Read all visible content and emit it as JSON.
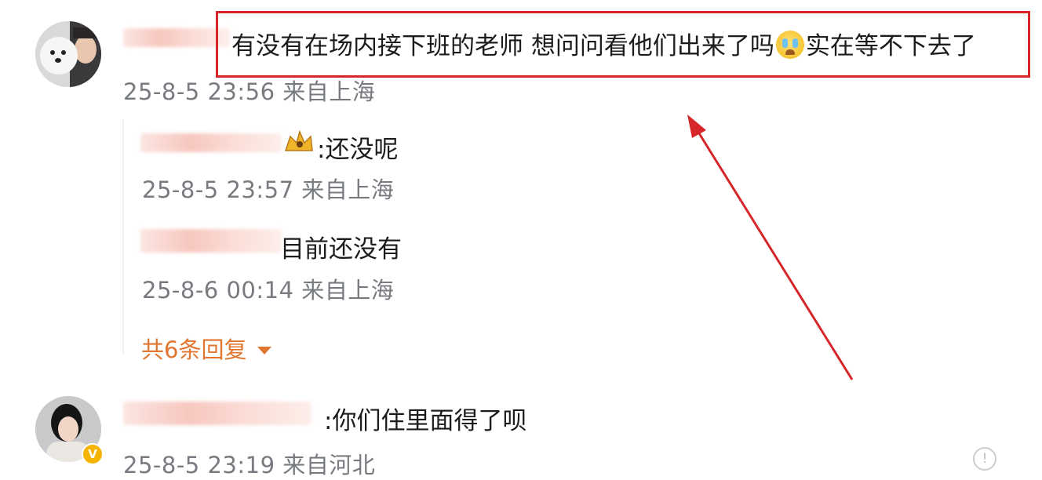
{
  "comments": [
    {
      "text": "有没有在场内接下班的老师 想问问看他们出来了吗",
      "emoji": "crying-face",
      "text_after_emoji": "实在等不下去了",
      "time": "25-8-5 23:56 来自上海",
      "replies": [
        {
          "text": ":还没呢",
          "time": "25-8-5 23:57 来自上海"
        },
        {
          "text": "目前还没有",
          "time": "25-8-6 00:14 来自上海"
        }
      ],
      "more_replies": "共6条回复"
    },
    {
      "text": ":你们住里面得了呗",
      "time": "25-8-5 23:19 来自河北",
      "verified_badge": "V"
    }
  ],
  "colors": {
    "highlight": "#d6262a",
    "more_replies": "#e2752f",
    "timestamp": "#777b80"
  }
}
